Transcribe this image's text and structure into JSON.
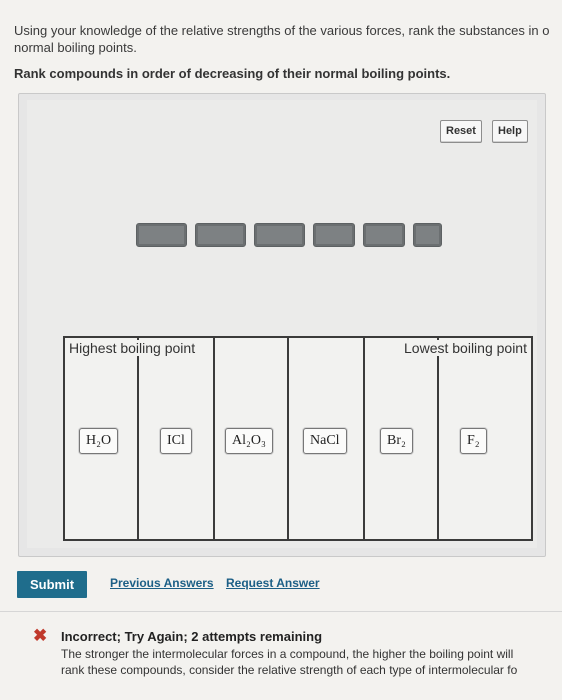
{
  "intro": {
    "line1": "Using your knowledge of the relative strengths of the various forces, rank the substances in o",
    "line2": "normal boiling points."
  },
  "task": "Rank compounds in order of decreasing of their normal boiling points.",
  "controls": {
    "reset": "Reset",
    "help": "Help"
  },
  "ranking": {
    "highest_label": "Highest boiling point",
    "lowest_label": "Lowest boiling point"
  },
  "chips": [
    "H₂O",
    "ICl",
    "Al₂O₃",
    "NaCl",
    "Br₂",
    "F₂"
  ],
  "actions": {
    "submit": "Submit",
    "previous": "Previous Answers",
    "request": "Request Answer"
  },
  "feedback": {
    "icon": "✖",
    "title": "Incorrect; Try Again; 2 attempts remaining",
    "line1": "The stronger the intermolecular forces in a compound, the higher the boiling point will",
    "line2": "rank these compounds, consider the relative strength of each type of intermolecular fo"
  }
}
